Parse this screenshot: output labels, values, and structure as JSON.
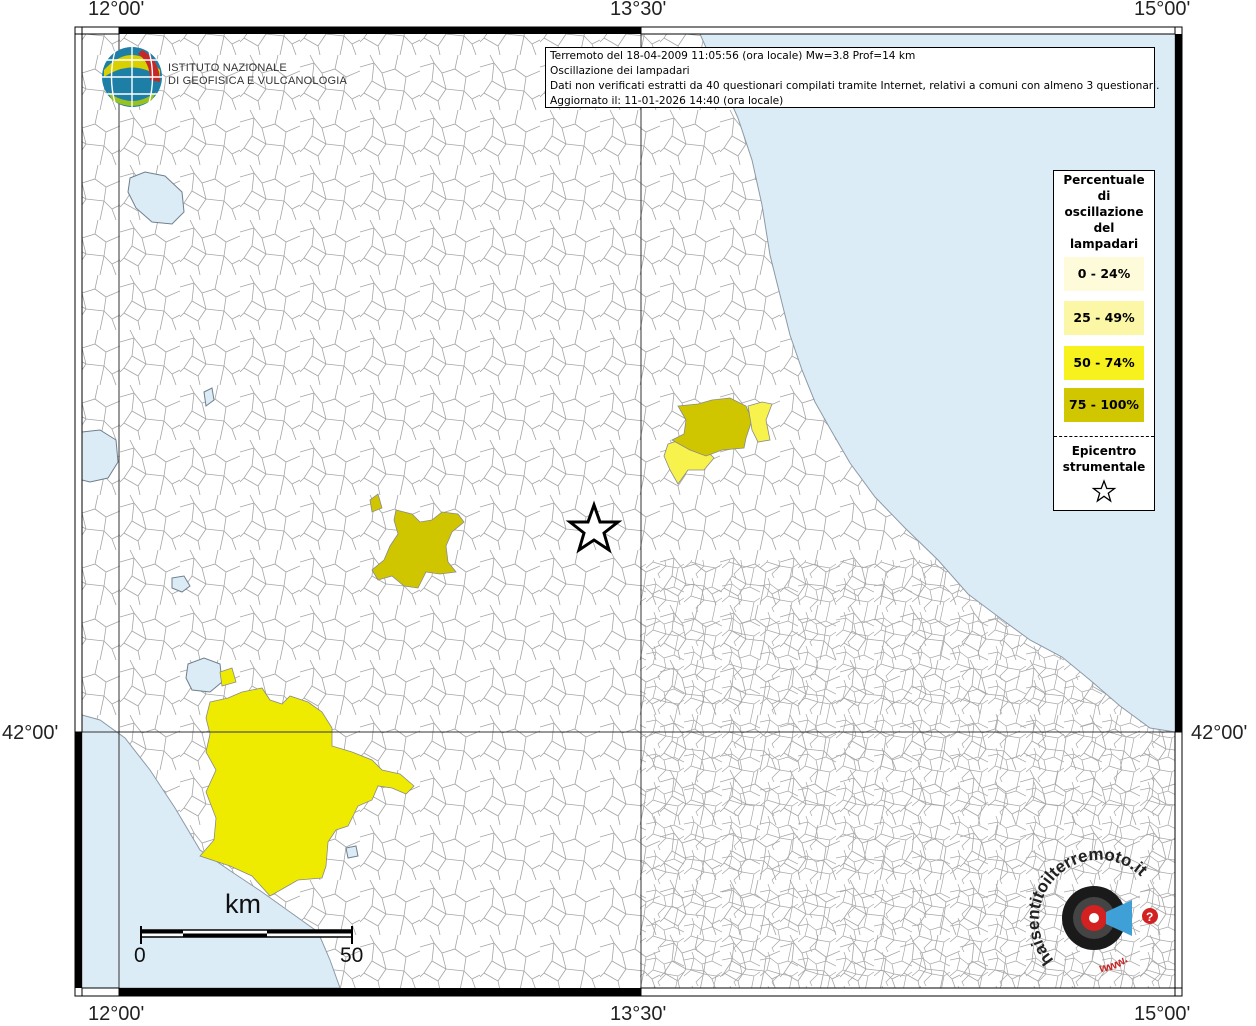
{
  "coordinates": {
    "top": [
      "12°00'",
      "13°30'",
      "15°00'"
    ],
    "bottom": [
      "12°00'",
      "13°30'",
      "15°00'"
    ],
    "left": "42°00'",
    "right": "42°00'"
  },
  "info": {
    "line1": "Terremoto del 18-04-2009 11:05:56 (ora locale) Mw=3.8 Prof=14 km",
    "line2": "Oscillazione dei lampadari",
    "line3": "Dati non verificati estratti da 40 questionari compilati tramite Internet, relativi a comuni con almeno 3 questionari.",
    "line4": "Aggiornato il: 11-01-2026 14:40 (ora locale)"
  },
  "legend": {
    "title_lines": [
      "Percentuale",
      "di",
      "oscillazione",
      "del",
      "lampadari"
    ],
    "classes": [
      {
        "label": "0 - 24%",
        "color": "#fdfbd9"
      },
      {
        "label": "25 - 49%",
        "color": "#fbf7a6"
      },
      {
        "label": "50 - 74%",
        "color": "#f7f21e"
      },
      {
        "label": "75 - 100%",
        "color": "#d1c700"
      }
    ],
    "epicenter_lines": [
      "Epicentro",
      "strumentale"
    ]
  },
  "logo": {
    "line1": "ISTITUTO NAZIONALE",
    "line2": "DI GEOFISICA E VULCANOLOGIA"
  },
  "scale": {
    "unit": "km",
    "start": "0",
    "end": "50"
  },
  "watermark": {
    "text": "haisentitoilterremoto.it",
    "url": "www."
  },
  "colors": {
    "sea": "#dcecf7",
    "land": "#ffffff",
    "yellow": "#eeeb00",
    "olive": "#cfc600",
    "pale_yellow": "#f7f24c",
    "boundary": "#9a9a9a"
  }
}
